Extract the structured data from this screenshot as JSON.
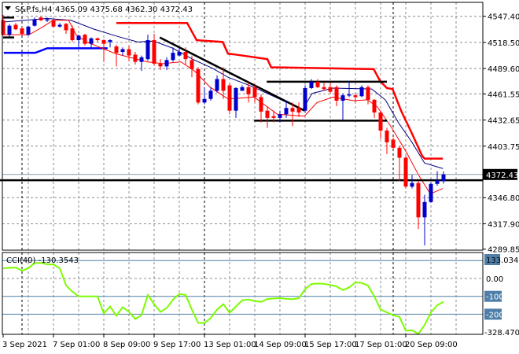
{
  "header": {
    "symbol": "S&P.fs,H4",
    "ohlc": "4365.09 4375.68 4362.30 4372.43"
  },
  "price_axis": {
    "ticks": [
      4547.4,
      4518.5,
      4489.6,
      4461.55,
      4432.65,
      4403.75,
      4346.8,
      4317.9,
      4289.85
    ],
    "tick_labels": [
      "4547.40",
      "4518.50",
      "4489.60",
      "4461.55",
      "4432.65",
      "4403.75",
      "4346.80",
      "4317.90",
      "4289.85"
    ],
    "current_price": 4372.43,
    "current_label": "4372.43",
    "range": [
      4289.85,
      4547.4
    ]
  },
  "cci": {
    "label": "CCI(40) -130.3543",
    "range": [
      -328.4701,
      133.0349
    ],
    "top_label": "133.0349",
    "bottom_label": "-328.4701",
    "zero_label": "0.00",
    "levels": [
      100,
      -100,
      -200
    ],
    "level_labels": [
      "-100",
      "-200"
    ],
    "top_box_label": "133",
    "values": [
      57,
      60,
      61,
      44,
      57,
      87,
      87,
      80,
      78,
      57,
      -39,
      -74,
      -100,
      -100,
      -100,
      -100,
      -196,
      -157,
      -209,
      -161,
      -187,
      -227,
      -205,
      -92,
      -144,
      -187,
      -166,
      -118,
      -87,
      -92,
      -174,
      -249,
      -249,
      -222,
      -174,
      -144,
      -192,
      -157,
      -122,
      -118,
      -126,
      -131,
      -115,
      -112,
      -110,
      -114,
      -116,
      -110,
      -60,
      -31,
      -28,
      -30,
      -36,
      -45,
      -65,
      -50,
      -22,
      -25,
      -40,
      -100,
      -174,
      -190,
      -205,
      -215,
      -292,
      -290,
      -310,
      -260,
      -190,
      -150,
      -130.35
    ]
  },
  "time_axis": {
    "labels": [
      {
        "bar": 0,
        "text": "3 Sep 2021"
      },
      {
        "bar": 8,
        "text": "7 Sep 01:00"
      },
      {
        "bar": 16,
        "text": "8 Sep 09:00"
      },
      {
        "bar": 24,
        "text": "9 Sep 17:00"
      },
      {
        "bar": 32,
        "text": "13 Sep 01:00"
      },
      {
        "bar": 40,
        "text": "14 Sep 09:00"
      },
      {
        "bar": 48,
        "text": "15 Sep 17:00"
      },
      {
        "bar": 56,
        "text": "17 Sep 01:00"
      },
      {
        "bar": 64,
        "text": "20 Sep 09:00"
      }
    ],
    "separators": [
      3,
      32,
      62
    ]
  },
  "colors": {
    "bull": "#0000cc",
    "bear": "#ff0000",
    "ma_navy": "#000080",
    "ma_red": "#ff0000",
    "channel_red": "#ff0000",
    "channel_blue": "#0000ff",
    "cci": "#7cfc00",
    "level": "#4f7fa8",
    "grid": "#8c8c96"
  },
  "candles": [
    [
      4543,
      4527,
      4549,
      4526
    ],
    [
      4527,
      4537,
      4539,
      4525
    ],
    [
      4538,
      4533,
      4540,
      4532
    ],
    [
      4534,
      4528,
      4536,
      4526
    ],
    [
      4527,
      4536,
      4537,
      4526
    ],
    [
      4537,
      4544,
      4546,
      4536
    ],
    [
      4546,
      4543,
      4547,
      4542
    ],
    [
      4543,
      4544,
      4546,
      4541
    ],
    [
      4543,
      4536,
      4545,
      4535
    ],
    [
      4536,
      4538,
      4540,
      4535
    ],
    [
      4539,
      4532,
      4540,
      4528
    ],
    [
      4534,
      4521,
      4537,
      4519
    ],
    [
      4521,
      4526,
      4527,
      4513
    ],
    [
      4527,
      4517,
      4528,
      4515
    ],
    [
      4517,
      4523,
      4524,
      4511
    ],
    [
      4523,
      4521,
      4524,
      4519
    ],
    [
      4521,
      4517,
      4522,
      4497
    ],
    [
      4519,
      4521,
      4522,
      4513
    ],
    [
      4514,
      4507,
      4516,
      4492
    ],
    [
      4508,
      4511,
      4513,
      4504
    ],
    [
      4511,
      4504,
      4515,
      4498
    ],
    [
      4505,
      4497,
      4508,
      4494
    ],
    [
      4497,
      4502,
      4504,
      4487
    ],
    [
      4500,
      4521,
      4527,
      4498
    ],
    [
      4521,
      4495,
      4528,
      4493
    ],
    [
      4495,
      4492,
      4500,
      4488
    ],
    [
      4492,
      4499,
      4502,
      4488
    ],
    [
      4499,
      4507,
      4513,
      4497
    ],
    [
      4504,
      4508,
      4513,
      4503
    ],
    [
      4508,
      4500,
      4513,
      4494
    ],
    [
      4499,
      4489,
      4504,
      4480
    ],
    [
      4489,
      4452,
      4491,
      4450
    ],
    [
      4452,
      4456,
      4469,
      4450
    ],
    [
      4456,
      4465,
      4469,
      4454
    ],
    [
      4465,
      4478,
      4482,
      4463
    ],
    [
      4478,
      4465,
      4491,
      4456
    ],
    [
      4471,
      4443,
      4474,
      4439
    ],
    [
      4443,
      4468,
      4469,
      4435
    ],
    [
      4465,
      4469,
      4471,
      4465
    ],
    [
      4469,
      4461,
      4474,
      4452
    ],
    [
      4469,
      4458,
      4471,
      4452
    ],
    [
      4458,
      4442,
      4461,
      4430
    ],
    [
      4443,
      4435,
      4448,
      4424
    ],
    [
      4437,
      4435,
      4443,
      4430
    ],
    [
      4435,
      4439,
      4443,
      4430
    ],
    [
      4439,
      4446,
      4454,
      4435
    ],
    [
      4446,
      4442,
      4452,
      4426
    ],
    [
      4446,
      4441,
      4452,
      4436
    ],
    [
      4443,
      4468,
      4471,
      4441
    ],
    [
      4468,
      4475,
      4478,
      4467
    ],
    [
      4475,
      4469,
      4478,
      4468
    ],
    [
      4469,
      4467,
      4474,
      4465
    ],
    [
      4469,
      4464,
      4474,
      4462
    ],
    [
      4469,
      4454,
      4471,
      4448
    ],
    [
      4454,
      4460,
      4462,
      4433
    ],
    [
      4460,
      4461,
      4476,
      4458
    ],
    [
      4460,
      4458,
      4462,
      4452
    ],
    [
      4459,
      4469,
      4471,
      4458
    ],
    [
      4469,
      4455,
      4471,
      4450
    ],
    [
      4455,
      4441,
      4456,
      4435
    ],
    [
      4441,
      4421,
      4443,
      4412
    ],
    [
      4421,
      4408,
      4424,
      4395
    ],
    [
      4411,
      4402,
      4413,
      4400
    ],
    [
      4402,
      4391,
      4404,
      4365
    ],
    [
      4391,
      4359,
      4393,
      4357
    ],
    [
      4359,
      4363,
      4372,
      4357
    ],
    [
      4363,
      4325,
      4365,
      4312
    ],
    [
      4325,
      4342,
      4350,
      4294
    ],
    [
      4342,
      4362,
      4364,
      4341
    ],
    [
      4362,
      4366,
      4376,
      4360
    ],
    [
      4365.09,
      4372.43,
      4375.68,
      4362.3
    ]
  ],
  "lines": {
    "ma_navy": [
      [
        0,
        4541
      ],
      [
        7,
        4545
      ],
      [
        10.75,
        4543
      ],
      [
        14.5,
        4533
      ],
      [
        18.25,
        4525
      ],
      [
        21.4,
        4519
      ],
      [
        23.9,
        4520
      ],
      [
        27,
        4512
      ],
      [
        30.1,
        4500
      ],
      [
        33.25,
        4490
      ],
      [
        35.75,
        4480
      ],
      [
        39.5,
        4470
      ],
      [
        43.25,
        4458
      ],
      [
        47.6,
        4444
      ],
      [
        49.1,
        4462
      ],
      [
        52.4,
        4468
      ],
      [
        58.6,
        4467
      ],
      [
        60.75,
        4455
      ],
      [
        62.9,
        4429
      ],
      [
        64.9,
        4409
      ],
      [
        67,
        4385
      ],
      [
        69.9,
        4379
      ]
    ],
    "ma_red": [
      [
        0.1,
        4527
      ],
      [
        4.1,
        4527
      ],
      [
        6.4,
        4536
      ],
      [
        7.9,
        4543
      ],
      [
        10.4,
        4543
      ],
      [
        11.6,
        4527
      ],
      [
        13.25,
        4519
      ],
      [
        17.9,
        4506
      ],
      [
        22.9,
        4497
      ],
      [
        25.4,
        4495
      ],
      [
        28.25,
        4497
      ],
      [
        30.4,
        4487
      ],
      [
        32.9,
        4469
      ],
      [
        35.75,
        4456
      ],
      [
        39.9,
        4458
      ],
      [
        43.6,
        4439
      ],
      [
        47.9,
        4437
      ],
      [
        49.9,
        4452
      ],
      [
        52.4,
        4458
      ],
      [
        55.75,
        4454
      ],
      [
        57.9,
        4455
      ],
      [
        59.5,
        4447
      ],
      [
        61.6,
        4426
      ],
      [
        64.1,
        4397
      ],
      [
        66.1,
        4371
      ],
      [
        67.9,
        4351
      ],
      [
        69.9,
        4357
      ]
    ],
    "channel_red": [
      [
        18,
        4540
      ],
      [
        29.25,
        4540
      ],
      [
        30.75,
        4521
      ],
      [
        34.9,
        4519
      ],
      [
        35.75,
        4506
      ],
      [
        37,
        4505
      ],
      [
        42,
        4500
      ],
      [
        42.6,
        4491
      ],
      [
        58.9,
        4489
      ],
      [
        59.9,
        4476
      ],
      [
        61,
        4468
      ],
      [
        61.9,
        4467
      ],
      [
        63.25,
        4443
      ],
      [
        64.9,
        4419
      ],
      [
        66.6,
        4393
      ],
      [
        67,
        4390
      ],
      [
        69.9,
        4390
      ]
    ],
    "channel_blue": [
      [
        0.1,
        4507
      ],
      [
        5.1,
        4507
      ],
      [
        7,
        4512
      ],
      [
        16.6,
        4512
      ]
    ],
    "stub_top": [
      [
        0,
        4546
      ],
      [
        1.75,
        4546
      ]
    ],
    "stub_bottom": [
      [
        0,
        4524
      ],
      [
        1.75,
        4524
      ]
    ],
    "trendline": [
      [
        24.9,
        4524
      ],
      [
        47.9,
        4443
      ]
    ],
    "range_top": [
      [
        41.9,
        4475
      ],
      [
        61,
        4475
      ]
    ],
    "range_bottom": [
      [
        39.9,
        4432
      ],
      [
        61,
        4432
      ]
    ],
    "support": 4366
  }
}
